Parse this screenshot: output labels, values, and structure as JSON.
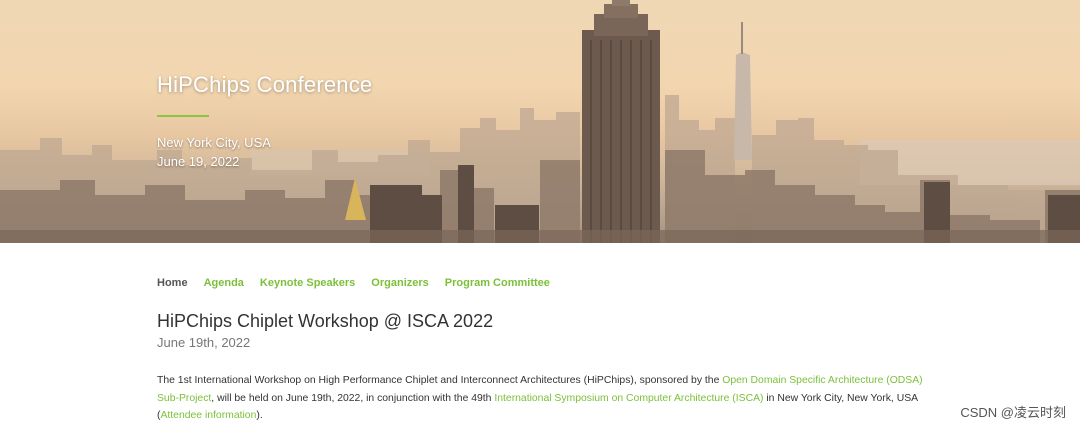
{
  "hero": {
    "title": "HiPChips Conference",
    "location": "New York City, USA",
    "date": "June 19, 2022"
  },
  "nav": {
    "items": [
      {
        "label": "Home",
        "active": true
      },
      {
        "label": "Agenda"
      },
      {
        "label": "Keynote Speakers"
      },
      {
        "label": "Organizers"
      },
      {
        "label": "Program Committee"
      }
    ]
  },
  "main": {
    "title": "HiPChips Chiplet Workshop @ ISCA 2022",
    "date": "June 19th, 2022",
    "intro": {
      "t1": "The 1st International Workshop on High Performance Chiplet and Interconnect Architectures (HiPChips), sponsored by the ",
      "link1": "Open Domain Specific Architecture (ODSA) Sub-Project",
      "t2": ", will be held on June 19th, 2022, in conjunction with the 49th ",
      "link2": "International Symposium on Computer Architecture (ISCA)",
      "t3": " in New York City, New York, USA  (",
      "link3": "Attendee information",
      "t4": ")."
    }
  },
  "watermark": "CSDN @凌云时刻",
  "colors": {
    "accent": "#7cc03a",
    "text": "#333333",
    "muted": "#777777"
  }
}
